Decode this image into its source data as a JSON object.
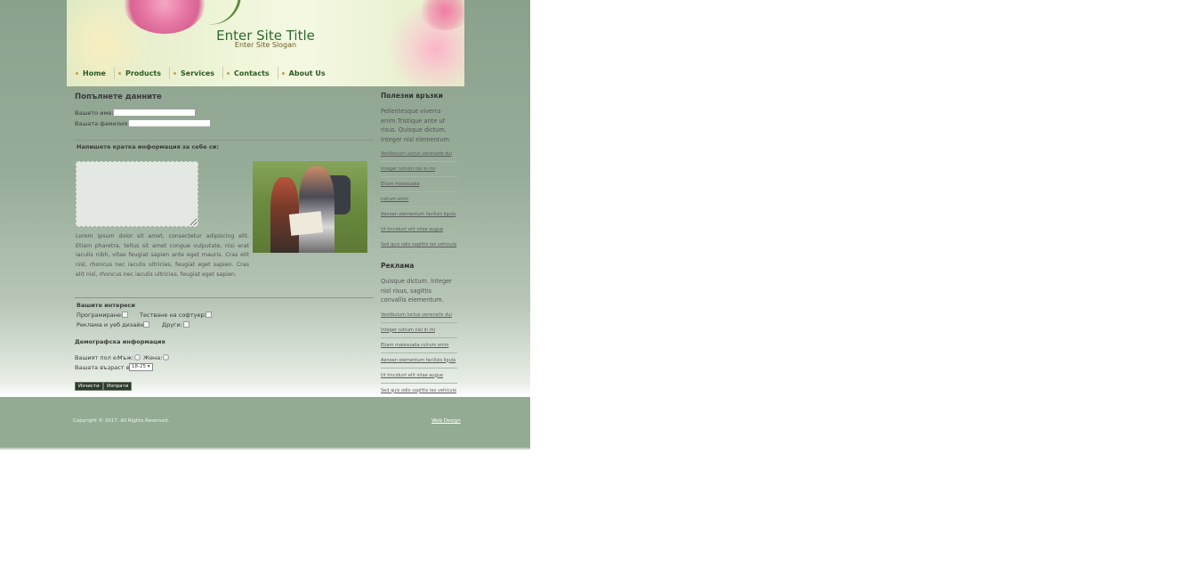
{
  "header": {
    "site_title": "Enter Site Title",
    "site_slogan": "Enter Site Slogan"
  },
  "nav": {
    "items": [
      "Home",
      "Products",
      "Services",
      "Contacts",
      "About Us"
    ]
  },
  "form": {
    "heading": "Попълнете данните",
    "first_name_label": "Вашето име:",
    "last_name_label": "Вашата фамилия:",
    "first_name_value": "",
    "last_name_value": "",
    "about_label": "Напишете кратка информация за себе си:",
    "lorem": "Lorem ipsum dolor sit amet, consectetur adipiscing elit. Etiam pharetra, tellus sit amet congue vulputate, nisi erat iaculis nibh, vitae feugiat sapien ante eget mauris. Cras elit nisl, rhoncus nec iaculis ultricies, feugiat eget sapien. Cras elit nisl, rhoncus nec iaculis ultricies, feugiat eget sapien.",
    "interests_heading": "Вашите интереси",
    "interest_programming": "Програмиране:",
    "interest_testing": "Тестване на софтуер:",
    "interest_ads_web": "Реклама и уеб дизайн:",
    "interest_other": "Други:",
    "demographics_heading": "Демографска информация",
    "gender_label": "Вашият пол е:",
    "gender_male": "Мъж:",
    "gender_female": "Жена:",
    "age_label": "Вашата възраст е:",
    "age_selected": "18-25",
    "clear_button": "Изчисти",
    "send_button": "Изпрати"
  },
  "sidebar": {
    "links_heading": "Полезни връзки",
    "links_text": "Pellentesque viverra enim.Tristique ante ut risus. Quisque dictum. Integer nisl elementum.",
    "links": [
      "Vestibulum luctus venenatis dui",
      "Integer rutrum nisl in mi",
      "Etiam malesuada",
      "rutrum enim",
      "Aenean elementum facilisis ligula",
      "Ut tincidunt elit vitae augue",
      "Sed quis odio sagittis leo vehicula"
    ],
    "ads_heading": "Реклама",
    "ads_text": "Quisque dictum. Integer nisl risus, sagittis convallis elementum.",
    "ads_links": [
      "Vestibulum luctus venenatis dui",
      "Integer rutrum nisl in mi",
      "Etiam malesuada rutrum enim",
      "Aenean elementum facilisis ligula",
      "Ut tincidunt elit vitae augue",
      "Sed quis odio sagittis leo vehicula"
    ]
  },
  "footer": {
    "copyright": "Copyright © 2017. All Rights Reserved.",
    "web_design": "Web Design"
  },
  "colors": {
    "page_green": "#93ab93",
    "title_green": "#2d6a2f",
    "button_dark": "#2f3b2c"
  },
  "icons": [
    "flower-image",
    "hikers-photo",
    "chevron-down-icon",
    "nav-bullet-icon"
  ]
}
